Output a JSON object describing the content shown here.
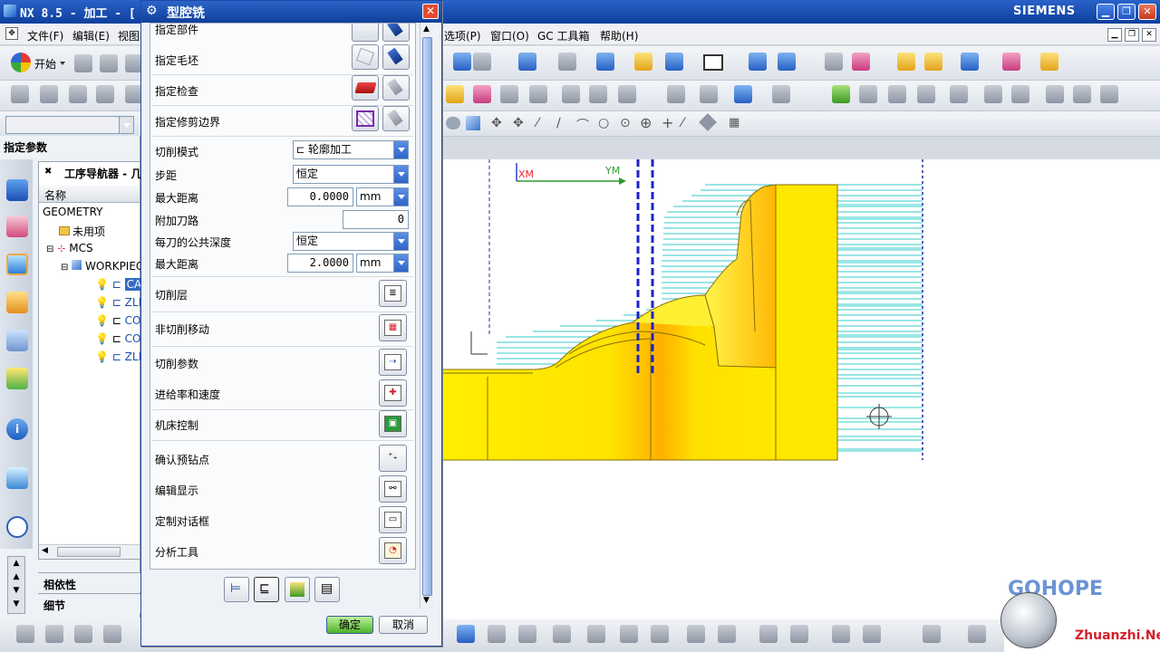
{
  "window": {
    "title": "NX 8.5 - 加工 - [",
    "brand": "SIEMENS"
  },
  "menubar": {
    "items": [
      "文件(F)",
      "编辑(E)",
      "视图",
      "选项(P)",
      "窗口(O)",
      "GC 工具箱",
      "帮助(H)"
    ]
  },
  "toolbar": {
    "start_label": "开始"
  },
  "left_panel": {
    "header": "指定参数",
    "navigator_title": "工序导航器 - 几",
    "column_name": "名称",
    "tree": [
      {
        "label": "GEOMETRY",
        "selected": false
      },
      {
        "label": "未用项",
        "selected": false
      },
      {
        "label": "MCS",
        "selected": false
      },
      {
        "label": "WORKPIECE",
        "selected": false
      },
      {
        "label": "CA",
        "selected": true
      },
      {
        "label": "ZLE",
        "selected": false
      },
      {
        "label": "CO",
        "selected": false
      },
      {
        "label": "CO",
        "selected": false
      },
      {
        "label": "ZLE",
        "selected": false
      }
    ],
    "section_dependency": "相依性",
    "section_detail": "细节"
  },
  "dialog": {
    "title": "型腔铣",
    "geometry_rows": [
      "指定部件",
      "指定毛坯",
      "指定检查",
      "指定修剪边界"
    ],
    "cut_mode_label": "切削模式",
    "cut_mode_value": "轮廓加工",
    "stepover_label": "步距",
    "stepover_value": "恒定",
    "max_distance_label": "最大距离",
    "max_distance_value": "0.0000",
    "unit": "mm",
    "extra_passes_label": "附加刀路",
    "extra_passes_value": "0",
    "depth_per_cut_label": "每刀的公共深度",
    "depth_per_cut_value": "恒定",
    "max_distance2_label": "最大距离",
    "max_distance2_value": "2.0000",
    "unit2": "mm",
    "actions": [
      "切削层",
      "非切削移动",
      "切削参数",
      "进给率和速度",
      "机床控制",
      "确认预钻点",
      "编辑显示",
      "定制对话框",
      "分析工具"
    ],
    "ok_label": "确定",
    "cancel_label": "取消"
  },
  "graphics": {
    "axis_x": "XM",
    "axis_y": "YM"
  },
  "watermark": {
    "brand": "GOHOPE",
    "url": "Zhuanzhi",
    "tld": ".Net"
  },
  "colors": {
    "titlebar": "#1a4aa8",
    "toolpath": "#37c8c8",
    "part_yellow": "#ffe600",
    "part_orange": "#ffa000"
  }
}
